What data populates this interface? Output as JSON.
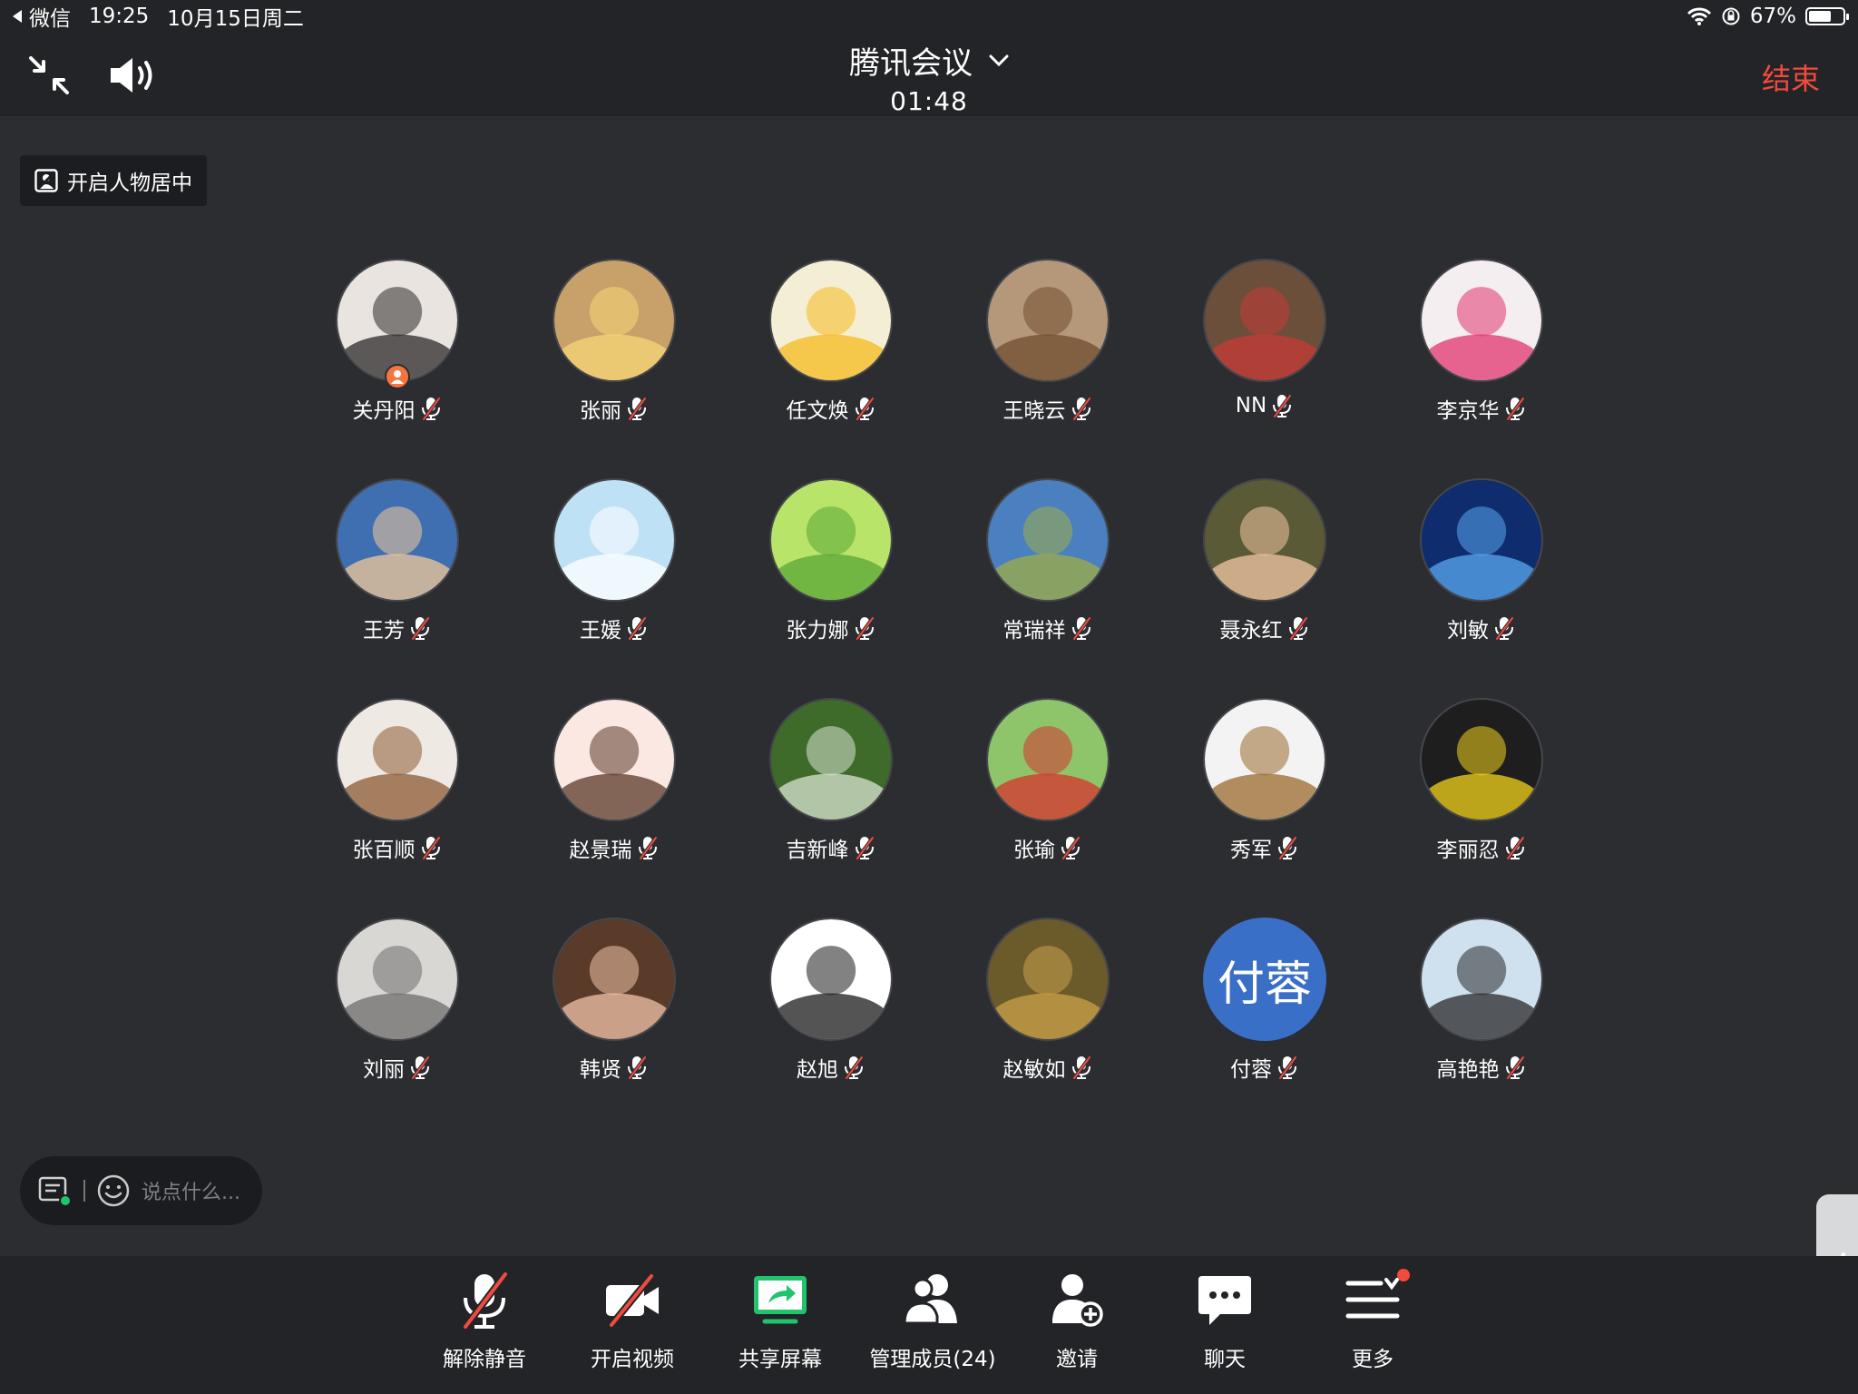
{
  "status_bar": {
    "back_app": "微信",
    "time": "19:25",
    "date": "10月15日周二",
    "battery_percent": "67%",
    "battery_level": 0.67
  },
  "header": {
    "title": "腾讯会议",
    "elapsed": "01:48",
    "end_label": "结束"
  },
  "center_toggle": {
    "label": "开启人物居中"
  },
  "participants": [
    {
      "name": "关丹阳",
      "host": true,
      "avatar_color": "#e9e4df",
      "avatar_accent": "#2c2a2a"
    },
    {
      "name": "张丽",
      "avatar_color": "#c7a06a",
      "avatar_accent": "#f7d777"
    },
    {
      "name": "任文焕",
      "avatar_color": "#f4efd4",
      "avatar_accent": "#f5b91c"
    },
    {
      "name": "王晓云",
      "avatar_color": "#b5977a",
      "avatar_accent": "#6f4e2e"
    },
    {
      "name": "NN",
      "avatar_color": "#6b4f3a",
      "avatar_accent": "#c73b37"
    },
    {
      "name": "李京华",
      "avatar_color": "#f4eef0",
      "avatar_accent": "#e0346d"
    },
    {
      "name": "王芳",
      "avatar_color": "#3f6fb0",
      "avatar_accent": "#f2c89a"
    },
    {
      "name": "王媛",
      "avatar_color": "#bfe1f5",
      "avatar_accent": "#ffffff"
    },
    {
      "name": "张力娜",
      "avatar_color": "#b8e46a",
      "avatar_accent": "#5aa536"
    },
    {
      "name": "常瑞祥",
      "avatar_color": "#4a7fc0",
      "avatar_accent": "#9fae46"
    },
    {
      "name": "聂永红",
      "avatar_color": "#5b5a36",
      "avatar_accent": "#f2c7a4"
    },
    {
      "name": "刘敏",
      "avatar_color": "#0f2c6e",
      "avatar_accent": "#5aa8f0"
    },
    {
      "name": "张百顺",
      "avatar_color": "#efe9e3",
      "avatar_accent": "#8c5a34"
    },
    {
      "name": "赵景瑞",
      "avatar_color": "#fbe8e2",
      "avatar_accent": "#5b3a2a"
    },
    {
      "name": "吉新峰",
      "avatar_color": "#3e6b2a",
      "avatar_accent": "#d9e4d2"
    },
    {
      "name": "张瑜",
      "avatar_color": "#8fc56a",
      "avatar_accent": "#d6322d"
    },
    {
      "name": "秀军",
      "avatar_color": "#f3f3f3",
      "avatar_accent": "#9a6a2d"
    },
    {
      "name": "李丽忍",
      "avatar_color": "#1e1e1e",
      "avatar_accent": "#f2d21b"
    },
    {
      "name": "刘丽",
      "avatar_color": "#d9d7d3",
      "avatar_accent": "#6d6d6d"
    },
    {
      "name": "韩贤",
      "avatar_color": "#5a3b2a",
      "avatar_accent": "#f1c3a8"
    },
    {
      "name": "赵旭",
      "avatar_color": "#ffffff",
      "avatar_accent": "#1b1b1b"
    },
    {
      "name": "赵敏如",
      "avatar_color": "#6b5a2a",
      "avatar_accent": "#c9a24a"
    },
    {
      "name": "付蓉",
      "initials": "付蓉",
      "avatar_color": "#3a6fc8",
      "avatar_accent": "#3a6fc8"
    },
    {
      "name": "高艳艳",
      "avatar_color": "#cfe0ef",
      "avatar_accent": "#2a2a2a"
    }
  ],
  "chat_input": {
    "placeholder": "说点什么..."
  },
  "toolbar": {
    "unmute": "解除静音",
    "video": "开启视频",
    "share": "共享屏幕",
    "members": "管理成员(24)",
    "invite": "邀请",
    "chat": "聊天",
    "more": "更多"
  },
  "colors": {
    "background": "#2b2d31",
    "bar": "#232427",
    "end_red": "#f24a3e",
    "share_green": "#21c46c"
  },
  "icons": {
    "mute": "mic-off-icon",
    "host": "host-badge-icon"
  }
}
